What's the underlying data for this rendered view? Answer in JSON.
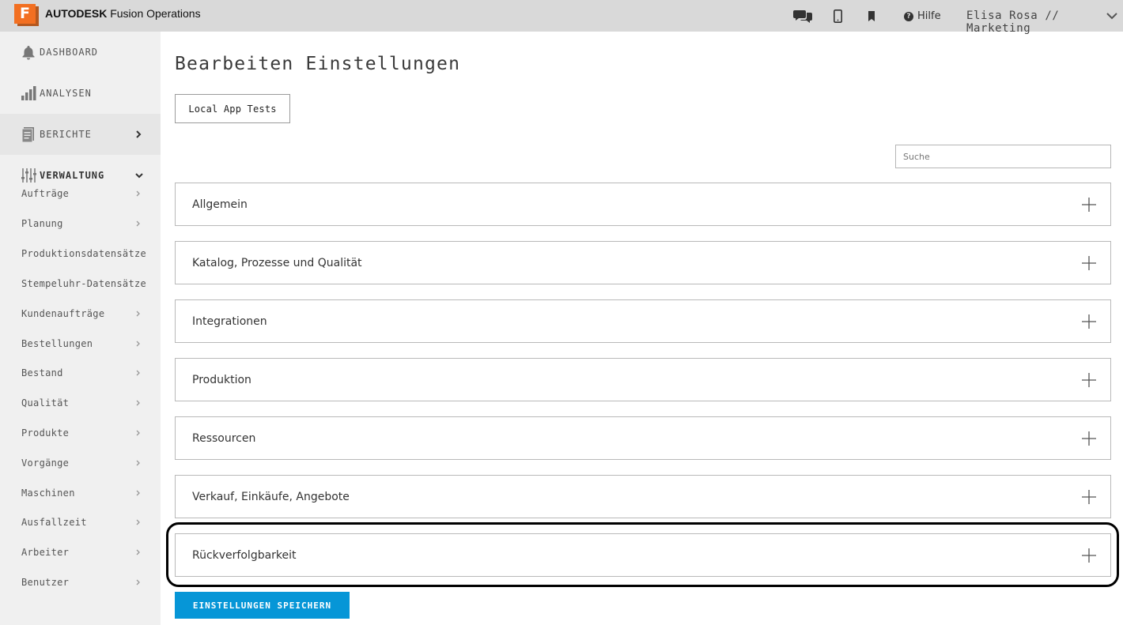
{
  "topbar": {
    "brand_bold": "AUTODESK",
    "brand_rest": "Fusion Operations",
    "logo_letter": "F",
    "help_label": "Hilfe",
    "user_label": "Elisa Rosa // Marketing",
    "icons": [
      "chat-icon",
      "mobile-icon",
      "bookmark-icon",
      "help-icon",
      "chevron-down-icon"
    ]
  },
  "sidebar": {
    "main_items": [
      {
        "label": "DASHBOARD",
        "icon": "bell-icon"
      },
      {
        "label": "ANALYSEN",
        "icon": "bar-chart-icon"
      },
      {
        "label": "BERICHTE",
        "icon": "report-icon"
      },
      {
        "label": "VERWALTUNG",
        "icon": "sliders-icon"
      }
    ],
    "sub_items": [
      {
        "label": "Aufträge",
        "has_chevron": true
      },
      {
        "label": "Planung",
        "has_chevron": true
      },
      {
        "label": "Produktionsdatensätze",
        "has_chevron": false
      },
      {
        "label": "Stempeluhr-Datensätze",
        "has_chevron": false
      },
      {
        "label": "Kundenaufträge",
        "has_chevron": true
      },
      {
        "label": "Bestellungen",
        "has_chevron": true
      },
      {
        "label": "Bestand",
        "has_chevron": true
      },
      {
        "label": "Qualität",
        "has_chevron": true
      },
      {
        "label": "Produkte",
        "has_chevron": true
      },
      {
        "label": "Vorgänge",
        "has_chevron": true
      },
      {
        "label": "Maschinen",
        "has_chevron": true
      },
      {
        "label": "Ausfallzeit",
        "has_chevron": true
      },
      {
        "label": "Arbeiter",
        "has_chevron": true
      },
      {
        "label": "Benutzer",
        "has_chevron": true
      }
    ]
  },
  "main": {
    "title": "Bearbeiten Einstellungen",
    "app_button_label": "Local App Tests",
    "search_placeholder": "Suche",
    "panels": [
      {
        "label": "Allgemein"
      },
      {
        "label": "Katalog, Prozesse und Qualität"
      },
      {
        "label": "Integrationen"
      },
      {
        "label": "Produktion"
      },
      {
        "label": "Ressourcen"
      },
      {
        "label": "Verkauf, Einkäufe, Angebote"
      },
      {
        "label": "Rückverfolgbarkeit"
      }
    ],
    "save_label": "EINSTELLUNGEN SPEICHERN"
  },
  "colors": {
    "topbar_bg": "#d9d9d9",
    "sidebar_bg": "#f0f0f0",
    "accent": "#0696d7",
    "logo_orange": "#f26f21"
  }
}
